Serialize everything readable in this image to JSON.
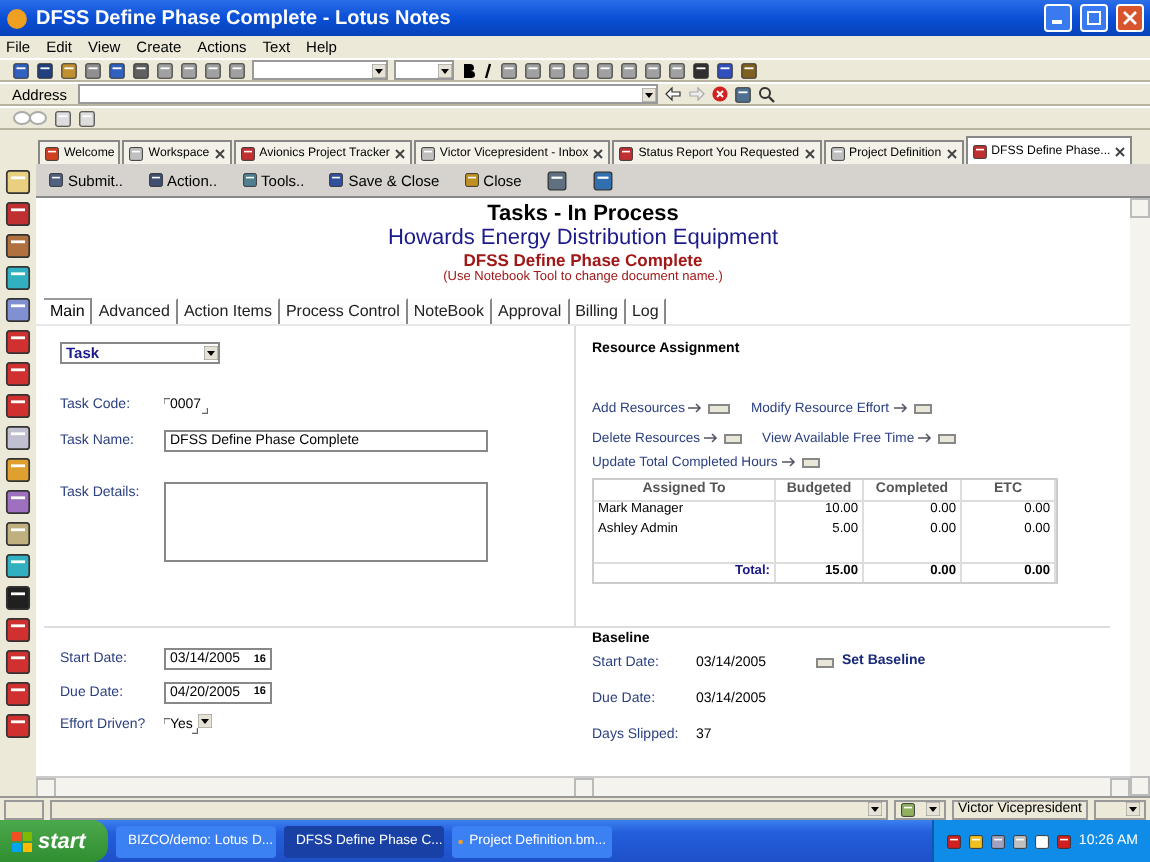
{
  "window": {
    "title": "DFSS Define Phase Complete - Lotus Notes"
  },
  "menu": [
    "File",
    "Edit",
    "View",
    "Create",
    "Actions",
    "Text",
    "Help"
  ],
  "address": {
    "label": "Address"
  },
  "doc_tabs": [
    {
      "label": "Welcome",
      "selected": false,
      "closable": false
    },
    {
      "label": "Workspace",
      "selected": false,
      "closable": true
    },
    {
      "label": "Avionics Project Tracker",
      "selected": false,
      "closable": true
    },
    {
      "label": "Victor Vicepresident - Inbox",
      "selected": false,
      "closable": true
    },
    {
      "label": "Status Report You Requested",
      "selected": false,
      "closable": true
    },
    {
      "label": "Project Definition",
      "selected": false,
      "closable": true
    },
    {
      "label": "DFSS Define Phase...",
      "selected": true,
      "closable": true
    }
  ],
  "actions": [
    "Submit..",
    "Action..",
    "Tools..",
    "Save & Close",
    "Close"
  ],
  "header": {
    "title": "Tasks - In Process",
    "company": "Howards Energy Distribution Equipment",
    "document": "DFSS Define Phase Complete",
    "hint": "(Use Notebook Tool to change document name.)"
  },
  "form_tabs": [
    {
      "label": "Main",
      "selected": true
    },
    {
      "label": "Advanced",
      "selected": false
    },
    {
      "label": "Action Items",
      "selected": false
    },
    {
      "label": "Process Control",
      "selected": false
    },
    {
      "label": "NoteBook",
      "selected": false
    },
    {
      "label": "Approval",
      "selected": false
    },
    {
      "label": "Billing",
      "selected": false
    },
    {
      "label": "Log",
      "selected": false
    }
  ],
  "type_select": "Task",
  "task": {
    "code_label": "Task Code:",
    "code": "0007",
    "name_label": "Task Name:",
    "name": "DFSS Define Phase Complete",
    "details_label": "Task Details:"
  },
  "resources": {
    "title": "Resource Assignment",
    "links": [
      [
        "Add Resources",
        "Modify Resource Effort"
      ],
      [
        "Delete Resources",
        "View Available Free Time"
      ],
      [
        "Update Total Completed Hours"
      ]
    ],
    "columns": [
      "Assigned To",
      "Budgeted",
      "Completed",
      "ETC"
    ],
    "rows": [
      [
        "Mark Manager",
        "10.00",
        "0.00",
        "0.00"
      ],
      [
        "Ashley Admin",
        "5.00",
        "0.00",
        "0.00"
      ]
    ],
    "total_label": "Total:",
    "totals": [
      "15.00",
      "0.00",
      "0.00"
    ]
  },
  "dates": {
    "start_label": "Start Date:",
    "start": "03/14/2005",
    "due_label": "Due Date:",
    "due": "04/20/2005",
    "effort_label": "Effort Driven?",
    "effort": "Yes",
    "start_calendar": "16",
    "due_calendar": "16"
  },
  "baseline": {
    "title": "Baseline",
    "start_label": "Start Date:",
    "start": "03/14/2005",
    "button": "Set Baseline",
    "due_label": "Due Date:",
    "due": "03/14/2005",
    "slipped_label": "Days Slipped:",
    "slipped": "37"
  },
  "status_bar": {
    "user": "Victor Vicepresident"
  },
  "taskbar": {
    "start": "start",
    "items": [
      {
        "label": "BIZCO/demo: Lotus D...",
        "selected": false
      },
      {
        "label": "DFSS Define Phase C...",
        "selected": true
      },
      {
        "label": "Project Definition.bm...",
        "selected": false
      }
    ],
    "clock": "10:26 AM"
  }
}
